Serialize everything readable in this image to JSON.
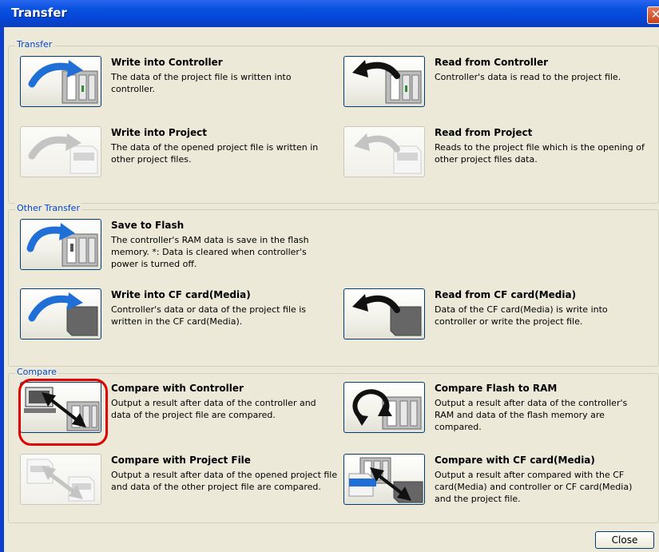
{
  "window": {
    "title": "Transfer",
    "close_glyph": "✕"
  },
  "groups": {
    "transfer": "Transfer",
    "other": "Other Transfer",
    "compare": "Compare"
  },
  "items": {
    "write_ctrl": {
      "title": "Write into Controller",
      "desc": "The data of the project file is written into controller."
    },
    "read_ctrl": {
      "title": "Read from Controller",
      "desc": "Controller's data is read to the project file."
    },
    "write_proj": {
      "title": "Write into Project",
      "desc": "The data of the opened project file is written in other project files."
    },
    "read_proj": {
      "title": "Read from Project",
      "desc": "Reads to the project file which is the opening of other project files data."
    },
    "save_flash": {
      "title": "Save to Flash",
      "desc": "The controller's RAM data is save in the flash memory. *: Data is cleared when controller's power is turned off."
    },
    "write_cf": {
      "title": "Write into CF card(Media)",
      "desc": "Controller's data or data of the project file is written in the CF card(Media)."
    },
    "read_cf": {
      "title": "Read from CF card(Media)",
      "desc": "Data of the CF card(Media) is write into controller or write the project file."
    },
    "cmp_ctrl": {
      "title": "Compare with Controller",
      "desc": "Output a result after data of the controller and data of the project file are compared."
    },
    "cmp_flash": {
      "title": "Compare Flash to RAM",
      "desc": "Output a result after data of the controller's RAM and data of the flash memory are compared."
    },
    "cmp_proj": {
      "title": "Compare with Project File",
      "desc": "Output a result after data of the opened project file and data of the other project file are compared."
    },
    "cmp_cf": {
      "title": "Compare with CF card(Media)",
      "desc": "Output a result after compared with the CF card(Media) and controller or CF card(Media) and the project file."
    }
  },
  "footer": {
    "close_label": "Close"
  },
  "colors": {
    "accent": "#0046d5",
    "highlight": "#e00000",
    "title_bar": "#0a52e0"
  }
}
